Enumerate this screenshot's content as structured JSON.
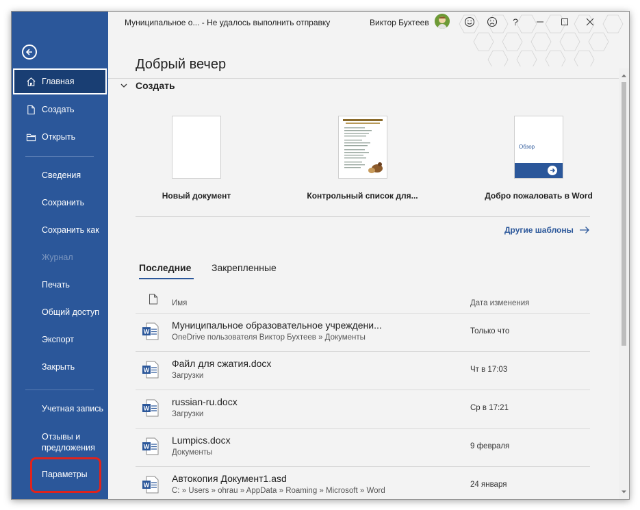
{
  "titlebar": {
    "doc_title": "Муниципальное о...  -  Не удалось выполнить отправку",
    "user_name": "Виктор Бухтеев",
    "buttons": [
      "smile-icon",
      "frown-icon",
      "help-icon",
      "minimize-icon",
      "maximize-icon",
      "close-icon"
    ],
    "help_glyph": "?"
  },
  "greeting": "Добрый вечер",
  "sidebar": {
    "items": [
      {
        "label": "Главная",
        "icon": "home-icon",
        "active": true
      },
      {
        "label": "Создать",
        "icon": "new-doc-icon"
      },
      {
        "label": "Открыть",
        "icon": "folder-icon"
      },
      {
        "label": "Сведения"
      },
      {
        "label": "Сохранить"
      },
      {
        "label": "Сохранить как"
      },
      {
        "label": "Журнал",
        "disabled": true
      },
      {
        "label": "Печать"
      },
      {
        "label": "Общий доступ"
      },
      {
        "label": "Экспорт"
      },
      {
        "label": "Закрыть"
      },
      {
        "label": "Учетная запись"
      },
      {
        "label": "Отзывы и предложения"
      },
      {
        "label": "Параметры",
        "highlighted": true
      }
    ],
    "feedback_line1": "Отзывы и",
    "feedback_line2": "предложения"
  },
  "create": {
    "header": "Создать",
    "templates": [
      {
        "label": "Новый документ"
      },
      {
        "label": "Контрольный список для..."
      },
      {
        "label": "Добро пожаловать в Word",
        "thumb_text": "Обзор"
      }
    ],
    "more_templates": "Другие шаблоны"
  },
  "tabs": {
    "recent": "Последние",
    "pinned": "Закрепленные"
  },
  "list": {
    "col_name": "Имя",
    "col_date": "Дата изменения",
    "rows": [
      {
        "name": "Муниципальное образовательное учреждени...",
        "path": "OneDrive пользователя Виктор Бухтеев » Документы",
        "date": "Только что"
      },
      {
        "name": "Файл для сжатия.docx",
        "path": "Загрузки",
        "date": "Чт в 17:03"
      },
      {
        "name": "russian-ru.docx",
        "path": "Загрузки",
        "date": "Ср в 17:21"
      },
      {
        "name": "Lumpics.docx",
        "path": "Документы",
        "date": "9 февраля"
      },
      {
        "name": "Автокопия Документ1.asd",
        "path": "C: » Users » ohrau » AppData » Roaming » Microsoft » Word",
        "date": "24 января"
      }
    ]
  },
  "colors": {
    "sidebar": "#2b579a",
    "highlight": "#e0231c",
    "link": "#2b579a"
  }
}
